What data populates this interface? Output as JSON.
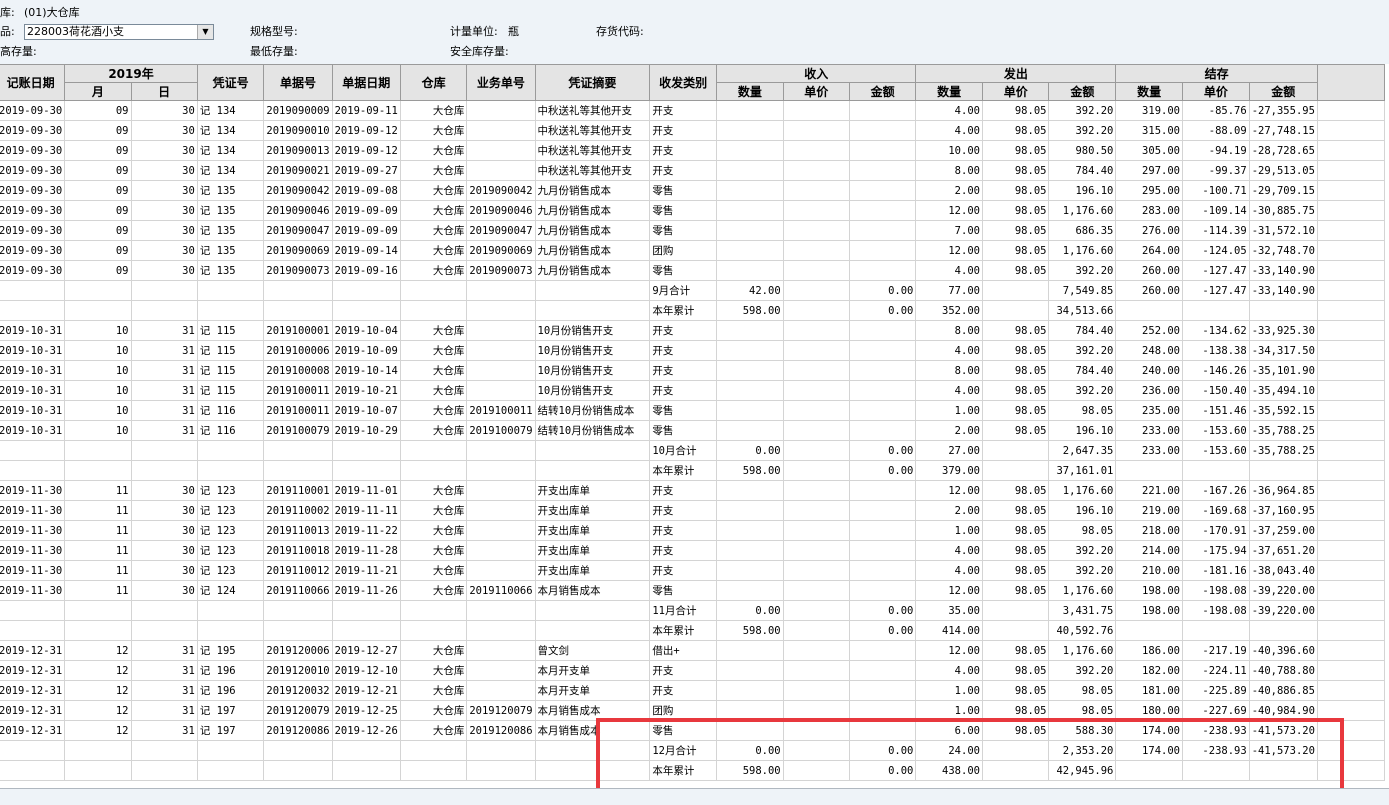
{
  "filters": {
    "warehouse_label": "库:",
    "warehouse_value": "(01)大仓库",
    "product_label": "品:",
    "product_value": "228003荷花酒小支",
    "spec_label": "规格型号:",
    "unit_label": "计量单位:",
    "unit_value": "瓶",
    "stock_code_label": "存货代码:",
    "max_stock_label": "高存量:",
    "min_stock_label": "最低存量:",
    "safety_stock_label": "安全库存量:"
  },
  "table": {
    "headers": {
      "date": "记账日期",
      "year": "2019年",
      "month": "月",
      "day": "日",
      "voucher": "凭证号",
      "doc": "单据号",
      "doc_date": "单据日期",
      "warehouse": "仓库",
      "biz": "业务单号",
      "summary": "凭证摘要",
      "type": "收发类别",
      "in": "收入",
      "out": "发出",
      "bal": "结存",
      "qty": "数量",
      "price": "单价",
      "amount": "金额"
    },
    "rows": [
      [
        "2019-09-30",
        "09",
        "30",
        "记 134",
        "2019090009",
        "2019-09-11",
        "大仓库",
        "",
        "中秋送礼等其他开支",
        "开支",
        "",
        "",
        "",
        "4.00",
        "98.05",
        "392.20",
        "319.00",
        "-85.76",
        "-27,355.95"
      ],
      [
        "2019-09-30",
        "09",
        "30",
        "记 134",
        "2019090010",
        "2019-09-12",
        "大仓库",
        "",
        "中秋送礼等其他开支",
        "开支",
        "",
        "",
        "",
        "4.00",
        "98.05",
        "392.20",
        "315.00",
        "-88.09",
        "-27,748.15"
      ],
      [
        "2019-09-30",
        "09",
        "30",
        "记 134",
        "2019090013",
        "2019-09-12",
        "大仓库",
        "",
        "中秋送礼等其他开支",
        "开支",
        "",
        "",
        "",
        "10.00",
        "98.05",
        "980.50",
        "305.00",
        "-94.19",
        "-28,728.65"
      ],
      [
        "2019-09-30",
        "09",
        "30",
        "记 134",
        "2019090021",
        "2019-09-27",
        "大仓库",
        "",
        "中秋送礼等其他开支",
        "开支",
        "",
        "",
        "",
        "8.00",
        "98.05",
        "784.40",
        "297.00",
        "-99.37",
        "-29,513.05"
      ],
      [
        "2019-09-30",
        "09",
        "30",
        "记 135",
        "2019090042",
        "2019-09-08",
        "大仓库",
        "2019090042",
        "九月份销售成本",
        "零售",
        "",
        "",
        "",
        "2.00",
        "98.05",
        "196.10",
        "295.00",
        "-100.71",
        "-29,709.15"
      ],
      [
        "2019-09-30",
        "09",
        "30",
        "记 135",
        "2019090046",
        "2019-09-09",
        "大仓库",
        "2019090046",
        "九月份销售成本",
        "零售",
        "",
        "",
        "",
        "12.00",
        "98.05",
        "1,176.60",
        "283.00",
        "-109.14",
        "-30,885.75"
      ],
      [
        "2019-09-30",
        "09",
        "30",
        "记 135",
        "2019090047",
        "2019-09-09",
        "大仓库",
        "2019090047",
        "九月份销售成本",
        "零售",
        "",
        "",
        "",
        "7.00",
        "98.05",
        "686.35",
        "276.00",
        "-114.39",
        "-31,572.10"
      ],
      [
        "2019-09-30",
        "09",
        "30",
        "记 135",
        "2019090069",
        "2019-09-14",
        "大仓库",
        "2019090069",
        "九月份销售成本",
        "团购",
        "",
        "",
        "",
        "12.00",
        "98.05",
        "1,176.60",
        "264.00",
        "-124.05",
        "-32,748.70"
      ],
      [
        "2019-09-30",
        "09",
        "30",
        "记 135",
        "2019090073",
        "2019-09-16",
        "大仓库",
        "2019090073",
        "九月份销售成本",
        "零售",
        "",
        "",
        "",
        "4.00",
        "98.05",
        "392.20",
        "260.00",
        "-127.47",
        "-33,140.90"
      ],
      [
        "",
        "",
        "",
        "",
        "",
        "",
        "",
        "",
        "",
        "9月合计",
        "42.00",
        "",
        "0.00",
        "77.00",
        "",
        "7,549.85",
        "260.00",
        "-127.47",
        "-33,140.90"
      ],
      [
        "",
        "",
        "",
        "",
        "",
        "",
        "",
        "",
        "",
        "本年累计",
        "598.00",
        "",
        "0.00",
        "352.00",
        "",
        "34,513.66",
        "",
        "",
        ""
      ],
      [
        "2019-10-31",
        "10",
        "31",
        "记 115",
        "2019100001",
        "2019-10-04",
        "大仓库",
        "",
        "10月份销售开支",
        "开支",
        "",
        "",
        "",
        "8.00",
        "98.05",
        "784.40",
        "252.00",
        "-134.62",
        "-33,925.30"
      ],
      [
        "2019-10-31",
        "10",
        "31",
        "记 115",
        "2019100006",
        "2019-10-09",
        "大仓库",
        "",
        "10月份销售开支",
        "开支",
        "",
        "",
        "",
        "4.00",
        "98.05",
        "392.20",
        "248.00",
        "-138.38",
        "-34,317.50"
      ],
      [
        "2019-10-31",
        "10",
        "31",
        "记 115",
        "2019100008",
        "2019-10-14",
        "大仓库",
        "",
        "10月份销售开支",
        "开支",
        "",
        "",
        "",
        "8.00",
        "98.05",
        "784.40",
        "240.00",
        "-146.26",
        "-35,101.90"
      ],
      [
        "2019-10-31",
        "10",
        "31",
        "记 115",
        "2019100011",
        "2019-10-21",
        "大仓库",
        "",
        "10月份销售开支",
        "开支",
        "",
        "",
        "",
        "4.00",
        "98.05",
        "392.20",
        "236.00",
        "-150.40",
        "-35,494.10"
      ],
      [
        "2019-10-31",
        "10",
        "31",
        "记 116",
        "2019100011",
        "2019-10-07",
        "大仓库",
        "2019100011",
        "结转10月份销售成本",
        "零售",
        "",
        "",
        "",
        "1.00",
        "98.05",
        "98.05",
        "235.00",
        "-151.46",
        "-35,592.15"
      ],
      [
        "2019-10-31",
        "10",
        "31",
        "记 116",
        "2019100079",
        "2019-10-29",
        "大仓库",
        "2019100079",
        "结转10月份销售成本",
        "零售",
        "",
        "",
        "",
        "2.00",
        "98.05",
        "196.10",
        "233.00",
        "-153.60",
        "-35,788.25"
      ],
      [
        "",
        "",
        "",
        "",
        "",
        "",
        "",
        "",
        "",
        "10月合计",
        "0.00",
        "",
        "0.00",
        "27.00",
        "",
        "2,647.35",
        "233.00",
        "-153.60",
        "-35,788.25"
      ],
      [
        "",
        "",
        "",
        "",
        "",
        "",
        "",
        "",
        "",
        "本年累计",
        "598.00",
        "",
        "0.00",
        "379.00",
        "",
        "37,161.01",
        "",
        "",
        ""
      ],
      [
        "2019-11-30",
        "11",
        "30",
        "记 123",
        "2019110001",
        "2019-11-01",
        "大仓库",
        "",
        "开支出库单",
        "开支",
        "",
        "",
        "",
        "12.00",
        "98.05",
        "1,176.60",
        "221.00",
        "-167.26",
        "-36,964.85"
      ],
      [
        "2019-11-30",
        "11",
        "30",
        "记 123",
        "2019110002",
        "2019-11-11",
        "大仓库",
        "",
        "开支出库单",
        "开支",
        "",
        "",
        "",
        "2.00",
        "98.05",
        "196.10",
        "219.00",
        "-169.68",
        "-37,160.95"
      ],
      [
        "2019-11-30",
        "11",
        "30",
        "记 123",
        "2019110013",
        "2019-11-22",
        "大仓库",
        "",
        "开支出库单",
        "开支",
        "",
        "",
        "",
        "1.00",
        "98.05",
        "98.05",
        "218.00",
        "-170.91",
        "-37,259.00"
      ],
      [
        "2019-11-30",
        "11",
        "30",
        "记 123",
        "2019110018",
        "2019-11-28",
        "大仓库",
        "",
        "开支出库单",
        "开支",
        "",
        "",
        "",
        "4.00",
        "98.05",
        "392.20",
        "214.00",
        "-175.94",
        "-37,651.20"
      ],
      [
        "2019-11-30",
        "11",
        "30",
        "记 123",
        "2019110012",
        "2019-11-21",
        "大仓库",
        "",
        "开支出库单",
        "开支",
        "",
        "",
        "",
        "4.00",
        "98.05",
        "392.20",
        "210.00",
        "-181.16",
        "-38,043.40"
      ],
      [
        "2019-11-30",
        "11",
        "30",
        "记 124",
        "2019110066",
        "2019-11-26",
        "大仓库",
        "2019110066",
        "本月销售成本",
        "零售",
        "",
        "",
        "",
        "12.00",
        "98.05",
        "1,176.60",
        "198.00",
        "-198.08",
        "-39,220.00"
      ],
      [
        "",
        "",
        "",
        "",
        "",
        "",
        "",
        "",
        "",
        "11月合计",
        "0.00",
        "",
        "0.00",
        "35.00",
        "",
        "3,431.75",
        "198.00",
        "-198.08",
        "-39,220.00"
      ],
      [
        "",
        "",
        "",
        "",
        "",
        "",
        "",
        "",
        "",
        "本年累计",
        "598.00",
        "",
        "0.00",
        "414.00",
        "",
        "40,592.76",
        "",
        "",
        ""
      ],
      [
        "2019-12-31",
        "12",
        "31",
        "记 195",
        "2019120006",
        "2019-12-27",
        "大仓库",
        "",
        "曾文剑",
        "借出+",
        "",
        "",
        "",
        "12.00",
        "98.05",
        "1,176.60",
        "186.00",
        "-217.19",
        "-40,396.60"
      ],
      [
        "2019-12-31",
        "12",
        "31",
        "记 196",
        "2019120010",
        "2019-12-10",
        "大仓库",
        "",
        "本月开支单",
        "开支",
        "",
        "",
        "",
        "4.00",
        "98.05",
        "392.20",
        "182.00",
        "-224.11",
        "-40,788.80"
      ],
      [
        "2019-12-31",
        "12",
        "31",
        "记 196",
        "2019120032",
        "2019-12-21",
        "大仓库",
        "",
        "本月开支单",
        "开支",
        "",
        "",
        "",
        "1.00",
        "98.05",
        "98.05",
        "181.00",
        "-225.89",
        "-40,886.85"
      ],
      [
        "2019-12-31",
        "12",
        "31",
        "记 197",
        "2019120079",
        "2019-12-25",
        "大仓库",
        "2019120079",
        "本月销售成本",
        "团购",
        "",
        "",
        "",
        "1.00",
        "98.05",
        "98.05",
        "180.00",
        "-227.69",
        "-40,984.90"
      ],
      [
        "2019-12-31",
        "12",
        "31",
        "记 197",
        "2019120086",
        "2019-12-26",
        "大仓库",
        "2019120086",
        "本月销售成本",
        "零售",
        "",
        "",
        "",
        "6.00",
        "98.05",
        "588.30",
        "174.00",
        "-238.93",
        "-41,573.20"
      ],
      [
        "",
        "",
        "",
        "",
        "",
        "",
        "",
        "",
        "",
        "12月合计",
        "0.00",
        "",
        "0.00",
        "24.00",
        "",
        "2,353.20",
        "174.00",
        "-238.93",
        "-41,573.20"
      ],
      [
        "",
        "",
        "",
        "",
        "",
        "",
        "",
        "",
        "",
        "本年累计",
        "598.00",
        "",
        "0.00",
        "438.00",
        "",
        "42,945.96",
        "",
        "",
        ""
      ]
    ]
  },
  "colors": {
    "highlight": "#e8383d",
    "header_bg": "#e4e4e4",
    "window_bg": "#eef3f8"
  }
}
